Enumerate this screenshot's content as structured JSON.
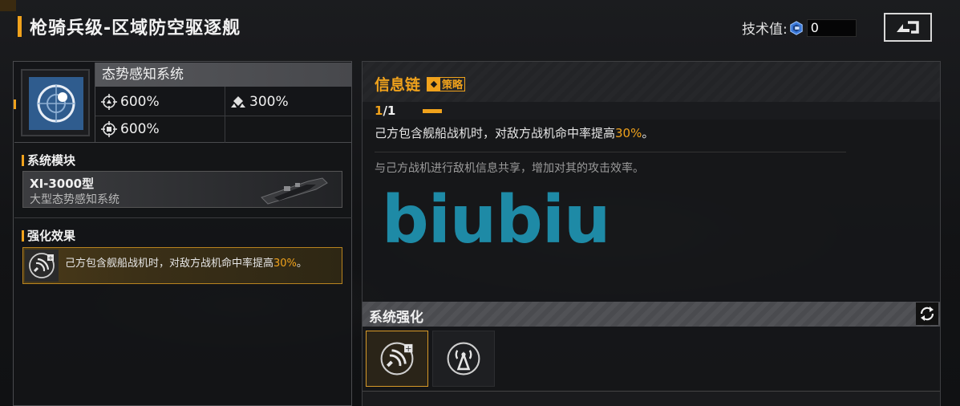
{
  "header": {
    "title": "枪骑兵级-区域防空驱逐舰",
    "tech_label": "技术值:",
    "tech_value": "0",
    "exit_icon": "exit-icon"
  },
  "system": {
    "name": "态势感知系统",
    "icon": "radar-target-icon",
    "stats": [
      {
        "icon": "anti-air-stat-icon",
        "value": "600%"
      },
      {
        "icon": "anti-ship-stat-icon",
        "value": "300%"
      },
      {
        "icon": "defense-stat-icon",
        "value": "600%"
      }
    ]
  },
  "module": {
    "section_label": "系统模块",
    "name": "XI-3000型",
    "subtitle": "大型态势感知系统"
  },
  "enhancement_effect": {
    "section_label": "强化效果",
    "text_prefix": "己方包含舰船战机时，对敌方战机命中率提高",
    "text_highlight": "30%",
    "text_suffix": "。"
  },
  "skill": {
    "title": "信息链",
    "tag": "策略",
    "level_current": "1",
    "level_sep": "/",
    "level_max": "1",
    "desc_prefix": "己方包含舰船战机时，对敌方战机命中率提高",
    "desc_highlight": "30%",
    "desc_suffix": "。",
    "flavor": "与己方战机进行敌机信息共享，增加对其的攻击效率。"
  },
  "watermark": "biubiu",
  "system_enhance": {
    "label": "系统强化",
    "refresh_icon": "refresh-icon",
    "slots": [
      {
        "icon": "signal-upgrade-icon",
        "selected": true
      },
      {
        "icon": "broadcast-tower-icon",
        "selected": false
      }
    ]
  },
  "colors": {
    "accent": "#f0a21c",
    "system_icon_bg": "#2f5c8e",
    "watermark": "#1e8aa6"
  }
}
